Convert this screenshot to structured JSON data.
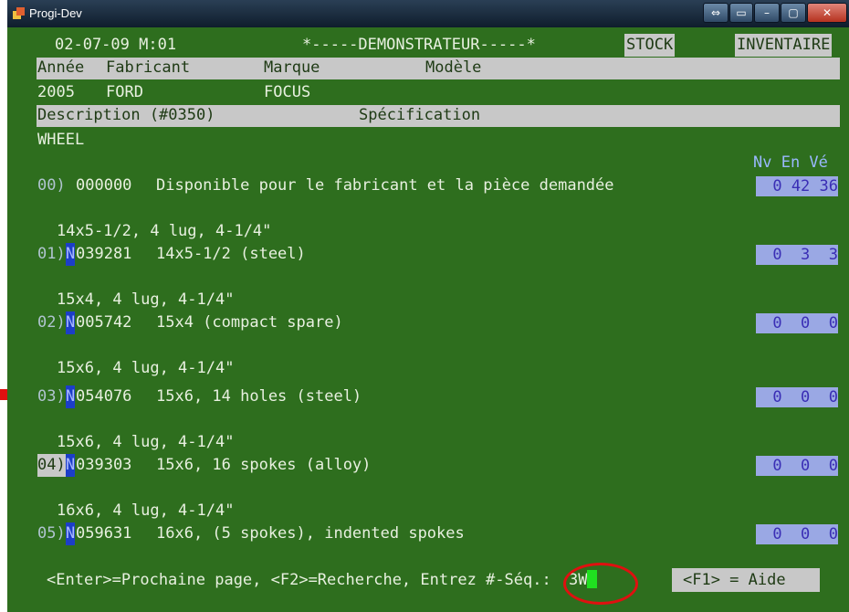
{
  "window": {
    "title": "Progi-Dev"
  },
  "header": {
    "datetime": "02-07-09 M:01",
    "banner": "*-----DEMONSTRATEUR-----*",
    "stock": "STOCK",
    "inventaire": "INVENTAIRE"
  },
  "vehicle": {
    "labels": {
      "annee": "Année",
      "fabricant": "Fabricant",
      "marque": "Marque",
      "modele": "Modèle"
    },
    "values": {
      "annee": "2005",
      "fabricant": "FORD",
      "marque": "FOCUS"
    }
  },
  "description": {
    "label": "Description (#0350)",
    "spec_label": "Spécification",
    "value": "WHEEL"
  },
  "qty_header": "Nv En Vé",
  "row00": {
    "num": "00)",
    "code": "000000",
    "text": "Disponible pour le fabricant et la pièce demandée",
    "qty": "0 42 36"
  },
  "items": [
    {
      "spec": "14x5-1/2, 4 lug, 4-1/4\"",
      "num": "01)",
      "flag": "N",
      "code": "039281",
      "desc": "14x5-1/2 (steel)",
      "qty": "0  3  3"
    },
    {
      "spec": "15x4, 4 lug, 4-1/4\"",
      "num": "02)",
      "flag": "N",
      "code": "005742",
      "desc": "15x4 (compact spare)",
      "qty": "0  0  0"
    },
    {
      "spec": "15x6, 4 lug, 4-1/4\"",
      "num": "03)",
      "flag": "N",
      "code": "054076",
      "desc": "15x6, 14 holes (steel)",
      "qty": "0  0  0"
    },
    {
      "spec": "15x6, 4 lug, 4-1/4\"",
      "num": "04)",
      "flag": "N",
      "code": "039303",
      "desc": "15x6, 16 spokes (alloy)",
      "qty": "0  0  0"
    },
    {
      "spec": "16x6, 4 lug, 4-1/4\"",
      "num": "05)",
      "flag": "N",
      "code": "059631",
      "desc": "16x6, (5 spokes), indented spokes",
      "qty": "0  0  0"
    }
  ],
  "footer": {
    "prompt": "<Enter>=Prochaine page, <F2>=Recherche, Entrez #-Séq.: ",
    "input_value": "3W",
    "help": "<F1> = Aide"
  },
  "colors": {
    "screen_bg": "#2e6e1e",
    "highlight_bar": "#c8c8c8",
    "cursor": "#20e020",
    "annotation": "#e01010"
  }
}
